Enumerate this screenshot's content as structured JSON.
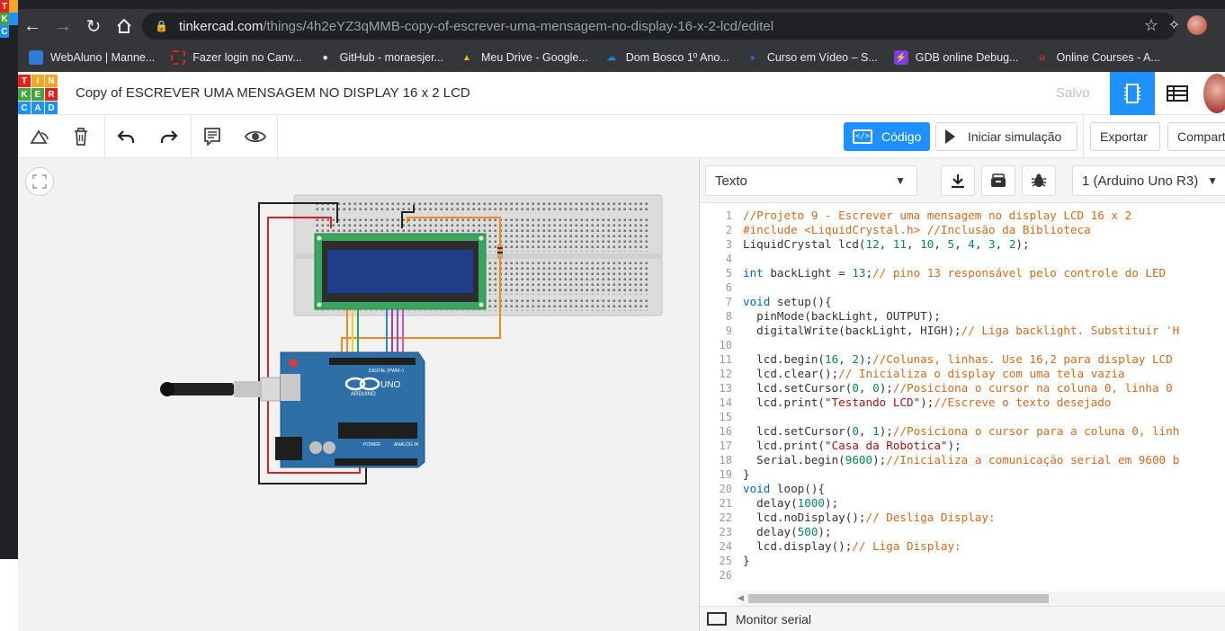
{
  "browser": {
    "url_host": "tinkercad.com",
    "url_path": "/things/4h2eYZ3qMMB-copy-of-escrever-uma-mensagem-no-display-16-x-2-lcd/editel",
    "bookmarks": [
      {
        "label": "WebAluno | Manne...",
        "icon": "webaluno-icon",
        "color": "#ffffff"
      },
      {
        "label": "Fazer login no Canv...",
        "icon": "canvas-icon",
        "color": "#e2231a"
      },
      {
        "label": "GitHub - moraesjer...",
        "icon": "github-icon",
        "color": "#ffffff"
      },
      {
        "label": "Meu Drive - Google...",
        "icon": "google-drive-icon",
        "color": "#fbbc04"
      },
      {
        "label": "Dom Bosco 1º Ano...",
        "icon": "cloud-icon",
        "color": "#0f8ddc"
      },
      {
        "label": "Curso em Vídeo – S...",
        "icon": "curso-em-video-icon",
        "color": "#2d5bff"
      },
      {
        "label": "GDB online Debug...",
        "icon": "gdb-icon",
        "color": "#7b3fe4"
      },
      {
        "label": "Online Courses - A...",
        "icon": "udemy-icon",
        "color": "#d62b2b"
      }
    ]
  },
  "header": {
    "logo_letters": [
      "T",
      "I",
      "N",
      "K",
      "E",
      "R",
      "C",
      "A",
      "D"
    ],
    "title": "Copy of ESCREVER UMA MENSAGEM NO DISPLAY 16 x 2 LCD",
    "status": "Salvo"
  },
  "toolbar": {
    "code_label": "Código",
    "simulate_label": "Iniciar simulação",
    "export_label": "Exportar",
    "share_label": "Compart"
  },
  "code_panel": {
    "mode": "Texto",
    "device": "1 (Arduino Uno R3)",
    "serial_monitor": "Monitor serial",
    "line_numbers": [
      "1",
      "2",
      "3",
      "4",
      "5",
      "6",
      "7",
      "8",
      "9",
      "10",
      "11",
      "12",
      "13",
      "14",
      "15",
      "16",
      "17",
      "18",
      "19",
      "20",
      "21",
      "22",
      "23",
      "24",
      "25",
      "26"
    ],
    "lines": [
      "//Projeto 9 - Escrever uma mensagem no display LCD 16 x 2",
      "#include <LiquidCrystal.h> //Inclusão da Biblioteca",
      "LiquidCrystal lcd(12, 11, 10, 5, 4, 3, 2);",
      "",
      "int backLight = 13;// pino 13 responsável pelo controle do LED",
      "",
      "void setup(){",
      "  pinMode(backLight, OUTPUT);",
      "  digitalWrite(backLight, HIGH);// Liga backlight. Substituir 'H",
      "",
      "  lcd.begin(16, 2);//Colunas, linhas. Use 16,2 para display LCD",
      "  lcd.clear();// Inicializa o display com uma tela vazia",
      "  lcd.setCursor(0, 0);//Posiciona o cursor na coluna 0, linha 0",
      "  lcd.print(\"Testando LCD\");//Escreve o texto desejado",
      "",
      "  lcd.setCursor(0, 1);//Posiciona o cursor para a coluna 0, linh",
      "  lcd.print(\"Casa da Robotica\");",
      "  Serial.begin(9600);//Inicializa a comunicação serial em 9600 b",
      "}",
      "void loop(){",
      "  delay(1000);",
      "  lcd.noDisplay();// Desliga Display:",
      "  delay(500);",
      "  lcd.display();// Liga Display:",
      "}",
      ""
    ]
  },
  "circuit": {
    "board_brand": "ARDUINO",
    "board_model": "UNO",
    "digital_label": "DIGITAL (PWM~)",
    "power_label": "POWER",
    "analog_label": "ANALOG IN"
  }
}
